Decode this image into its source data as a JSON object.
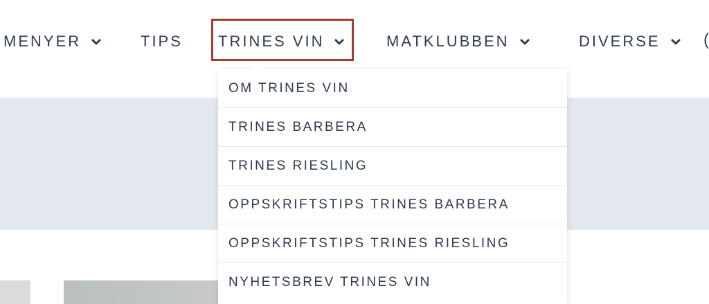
{
  "nav": {
    "items": [
      {
        "label": "MENYER",
        "has_dropdown": true
      },
      {
        "label": "TIPS",
        "has_dropdown": false
      },
      {
        "label": "TRINES VIN",
        "has_dropdown": true,
        "active": true
      },
      {
        "label": "MATKLUBBEN",
        "has_dropdown": true
      },
      {
        "label": "DIVERSE",
        "has_dropdown": true
      }
    ],
    "trailing_icon": "(",
    "active_outline_color": "#a83a2c"
  },
  "dropdown": {
    "items": [
      {
        "label": "OM TRINES VIN"
      },
      {
        "label": "TRINES BARBERA"
      },
      {
        "label": "TRINES RIESLING"
      },
      {
        "label": "OPPSKRIFTSTIPS TRINES BARBERA"
      },
      {
        "label": "OPPSKRIFTSTIPS TRINES RIESLING"
      },
      {
        "label": "NYHETSBREV TRINES VIN"
      }
    ]
  },
  "colors": {
    "text": "#2d3b4e",
    "band": "#e3e8f1",
    "highlight": "#a83a2c"
  }
}
